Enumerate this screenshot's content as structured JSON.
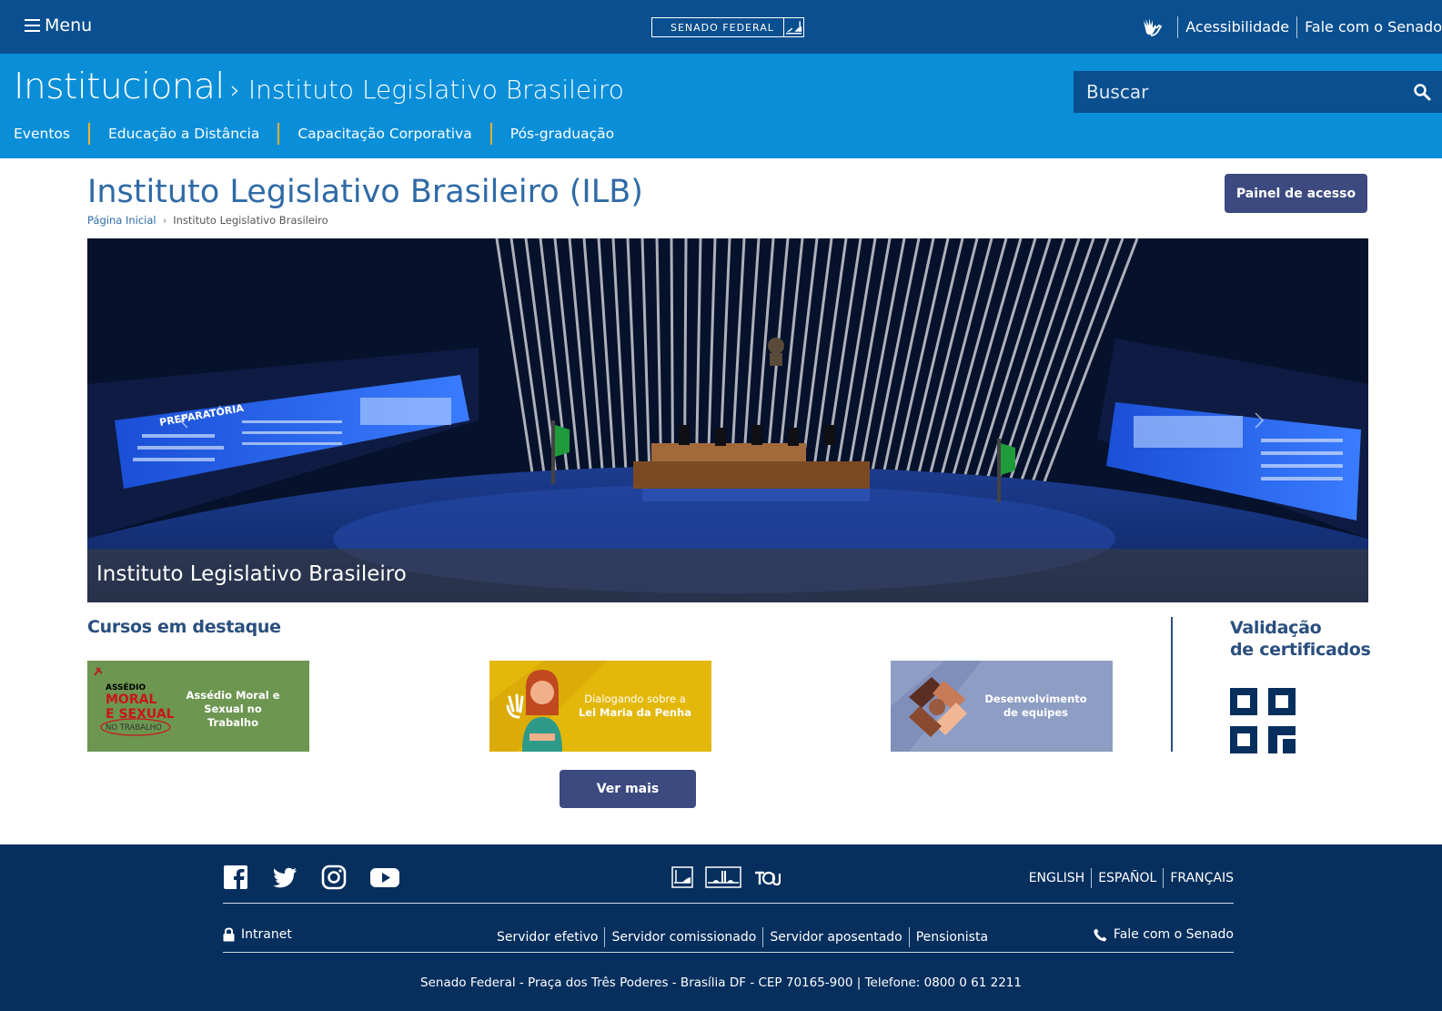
{
  "topbar": {
    "menu_label": "Menu",
    "logo_text": "SENADO FEDERAL",
    "accessibility_label": "Acessibilidade",
    "contact_label": "Fale com o Senado"
  },
  "header": {
    "section": "Institucional",
    "subsection": "› Instituto Legislativo Brasileiro",
    "search_placeholder": "Buscar",
    "nav": [
      "Eventos",
      "Educação a Distância",
      "Capacitação Corporativa",
      "Pós-graduação"
    ]
  },
  "page": {
    "title": "Instituto Legislativo Brasileiro (ILB)",
    "breadcrumb_home": "Página Inicial",
    "breadcrumb_separator": "›",
    "breadcrumb_current": "Instituto Legislativo Brasileiro",
    "access_button": "Painel de acesso"
  },
  "carousel": {
    "caption": "Instituto Legislativo Brasileiro",
    "screen_text": "PREPARATÓRIA"
  },
  "courses": {
    "title": "Cursos em destaque",
    "items": [
      {
        "heading": "Assédio Moral e Sexual no Trabalho",
        "logo_line1": "ASSÉDIO",
        "logo_line2": "MORAL",
        "logo_line3": "E SEXUAL",
        "logo_line4": "NO TRABALHO",
        "line1": "Assédio Moral e",
        "line2": "Sexual no Trabalho"
      },
      {
        "line1": "Dialogando sobre a",
        "line2": "Lei Maria da Penha"
      },
      {
        "line1": "Desenvolvimento",
        "line2": "de equipes"
      }
    ],
    "more_button": "Ver mais"
  },
  "certificates": {
    "line1": "Validação",
    "line2": "de certificados"
  },
  "footer": {
    "languages": [
      "ENGLISH",
      "ESPAÑOL",
      "FRANÇAIS"
    ],
    "intranet": "Intranet",
    "servers": [
      "Servidor efetivo",
      "Servidor comissionado",
      "Servidor aposentado",
      "Pensionista"
    ],
    "contact": "Fale com o Senado",
    "address": "Senado Federal - Praça dos Três Poderes - Brasília DF - CEP 70165-900 | Telefone: 0800 0 61 2211"
  },
  "colors": {
    "topbar": "#0a4f8f",
    "header": "#0a8ed8",
    "accent_separator": "#f3b229",
    "button": "#3c4a80",
    "footer": "#062f5e",
    "title": "#2f6aa6"
  }
}
